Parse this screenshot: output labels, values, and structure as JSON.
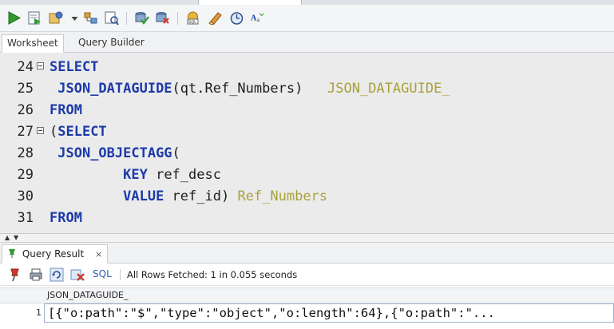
{
  "toolbar": {
    "icons": [
      "run-statement-icon",
      "run-script-icon",
      "autotrace-icon",
      "dropdown-arrow-icon",
      "explain-plan-icon",
      "sql-tuning-icon",
      "commit-icon",
      "rollback-icon",
      "unshared-sql-icon",
      "clear-icon",
      "sql-history-icon",
      "format-case-icon"
    ]
  },
  "editor_tabs": {
    "worksheet": "Worksheet",
    "query_builder": "Query Builder"
  },
  "editor": {
    "lines": [
      {
        "num": "24",
        "fold": true,
        "indent": "",
        "parts": [
          {
            "t": "SELECT",
            "c": "kw"
          }
        ]
      },
      {
        "num": "25",
        "fold": false,
        "indent": " ",
        "parts": [
          {
            "t": "JSON_DATAGUIDE",
            "c": "kw"
          },
          {
            "t": "(qt.Ref_Numbers)   ",
            "c": ""
          },
          {
            "t": "JSON_DATAGUIDE_",
            "c": "alias"
          }
        ]
      },
      {
        "num": "26",
        "fold": false,
        "indent": "",
        "parts": [
          {
            "t": "FROM",
            "c": "kw"
          }
        ]
      },
      {
        "num": "27",
        "fold": true,
        "indent": "",
        "parts": [
          {
            "t": "(",
            "c": ""
          },
          {
            "t": "SELECT",
            "c": "kw"
          }
        ]
      },
      {
        "num": "28",
        "fold": false,
        "indent": " ",
        "parts": [
          {
            "t": "JSON_OBJECTAGG",
            "c": "kw"
          },
          {
            "t": "(",
            "c": ""
          }
        ]
      },
      {
        "num": "29",
        "fold": false,
        "indent": "         ",
        "parts": [
          {
            "t": "KEY",
            "c": "kw"
          },
          {
            "t": " ref_desc",
            "c": ""
          }
        ]
      },
      {
        "num": "30",
        "fold": false,
        "indent": "         ",
        "parts": [
          {
            "t": "VALUE",
            "c": "kw"
          },
          {
            "t": " ref_id) ",
            "c": ""
          },
          {
            "t": "Ref_Numbers",
            "c": "alias"
          }
        ]
      },
      {
        "num": "31",
        "fold": false,
        "indent": "",
        "parts": [
          {
            "t": "FROM",
            "c": "kw"
          }
        ]
      }
    ]
  },
  "results": {
    "tab_label": "Query Result",
    "close_glyph": "×",
    "sql_link": "SQL",
    "status": "All Rows Fetched: 1 in 0.055 seconds",
    "column_header": "JSON_DATAGUIDE_",
    "rows": [
      {
        "num": "1",
        "value": "[{\"o:path\":\"$\",\"type\":\"object\",\"o:length\":64},{\"o:path\":\"..."
      }
    ]
  }
}
